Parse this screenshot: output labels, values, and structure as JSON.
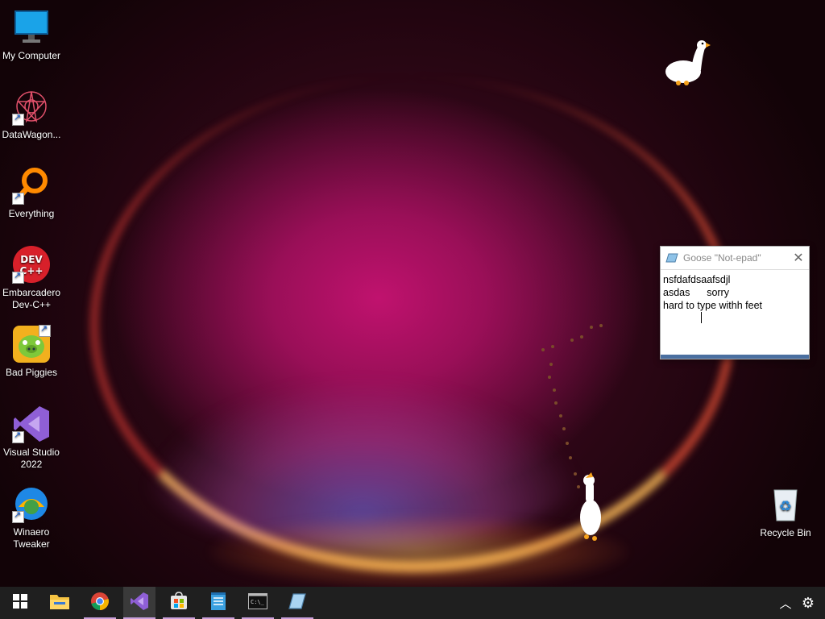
{
  "desktop_icons": [
    {
      "label": "My Computer",
      "icon": "monitor-icon",
      "shortcut": false
    },
    {
      "label": "DataWagon...",
      "icon": "datawagon-icon",
      "shortcut": true
    },
    {
      "label": "Everything",
      "icon": "everything-search-icon",
      "shortcut": true
    },
    {
      "label": "Embarcadero Dev-C++",
      "icon": "devcpp-icon",
      "shortcut": true
    },
    {
      "label": "Bad Piggies",
      "icon": "bad-piggies-icon",
      "shortcut": true
    },
    {
      "label": "Visual Studio 2022",
      "icon": "visual-studio-icon",
      "shortcut": true
    },
    {
      "label": "Winaero Tweaker",
      "icon": "winaero-tweaker-icon",
      "shortcut": true
    },
    {
      "label": "Recycle Bin",
      "icon": "recycle-bin-icon",
      "shortcut": false
    }
  ],
  "notepad": {
    "title": "Goose \"Not-epad\"",
    "lines": [
      "nsfdafdsaafsdjl",
      "asdas      sorry",
      "hard to type withh feet"
    ]
  },
  "taskbar": {
    "items": [
      "start-icon",
      "file-explorer-icon",
      "chrome-icon",
      "visual-studio-icon",
      "microsoft-store-icon",
      "notepad-icon",
      "terminal-icon",
      "goose-notepad-icon"
    ],
    "active": "visual-studio-icon",
    "tray": [
      "chevron-up-icon",
      "settings-gear-icon"
    ]
  },
  "colors": {
    "accent_underline": "#c9a0dc",
    "taskbar": "#1f1f1f"
  }
}
